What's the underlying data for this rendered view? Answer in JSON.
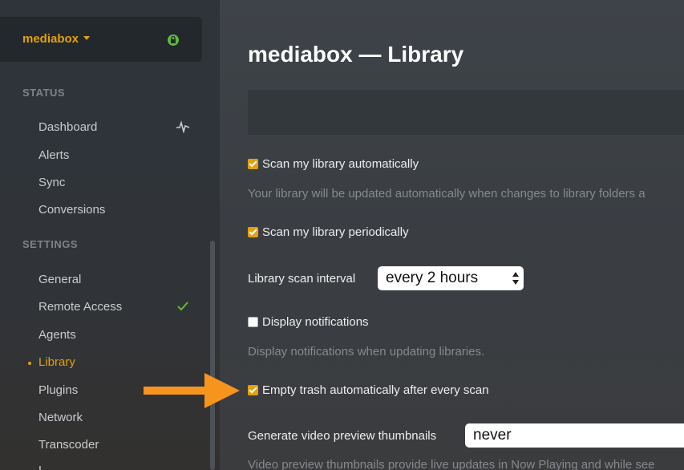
{
  "sidebar": {
    "server_name": "mediabox",
    "sections": [
      {
        "title": "STATUS",
        "items": [
          "Dashboard",
          "Alerts",
          "Sync",
          "Conversions"
        ]
      },
      {
        "title": "SETTINGS",
        "items": [
          "General",
          "Remote Access",
          "Agents",
          "Library",
          "Plugins",
          "Network",
          "Transcoder",
          "L"
        ]
      }
    ],
    "active_item": "Library",
    "icons": {
      "server": "lock-icon",
      "dashboard": "pulse-icon",
      "remote_access": "check-icon"
    }
  },
  "main": {
    "title": "mediabox — Library",
    "options": {
      "scan_auto": {
        "label": "Scan my library automatically",
        "checked": true,
        "help": "Your library will be updated automatically when changes to library folders a"
      },
      "scan_periodic": {
        "label": "Scan my library periodically",
        "checked": true
      },
      "scan_interval": {
        "label": "Library scan interval",
        "value": "every 2 hours"
      },
      "notifications": {
        "label": "Display notifications",
        "checked": false,
        "help": "Display notifications when updating libraries."
      },
      "empty_trash": {
        "label": "Empty trash automatically after every scan",
        "checked": true
      },
      "thumbnails": {
        "label": "Generate video preview thumbnails",
        "value": "never",
        "help": "Video preview thumbnails provide live updates in Now Playing and while see"
      }
    }
  },
  "colors": {
    "accent": "#e5a00d",
    "arrow": "#f7941d",
    "success": "#5fb83a"
  }
}
